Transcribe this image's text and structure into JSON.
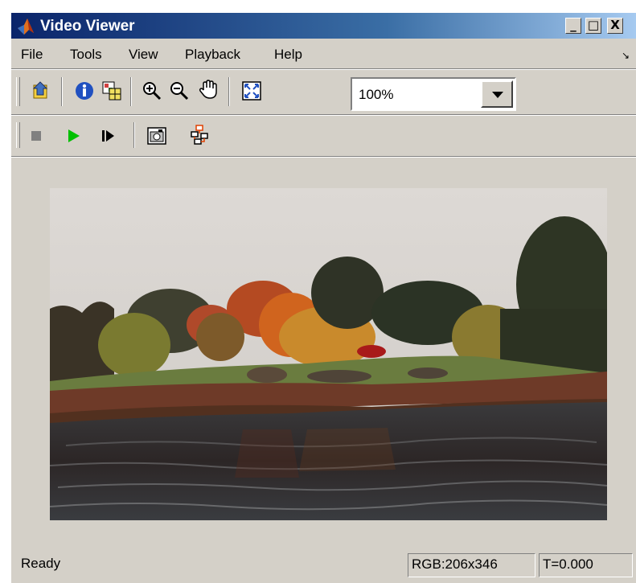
{
  "window": {
    "title": "Video Viewer"
  },
  "title_buttons": {
    "minimize": "_",
    "maximize": "□",
    "close": "X"
  },
  "menu": [
    "File",
    "Tools",
    "View",
    "Playback",
    "Help"
  ],
  "toolbar1": {
    "icons": [
      "open-source-icon",
      "info-icon",
      "pixel-region-icon",
      "zoom-in-icon",
      "zoom-out-icon",
      "pan-hand-icon",
      "fit-to-view-icon"
    ],
    "zoom": {
      "value": "100%"
    }
  },
  "toolbar2": {
    "icons": [
      "stop-icon",
      "play-icon",
      "step-forward-icon",
      "snapshot-icon",
      "highlight-viewer-icon"
    ]
  },
  "status": {
    "text": "Ready",
    "dims": "RGB:206x346",
    "time": "T=0.000"
  },
  "colors": {
    "titlebar_start": "#0a246a",
    "titlebar_end": "#a6caf0",
    "window_bg": "#d4d0c8",
    "play": "#00c000"
  }
}
